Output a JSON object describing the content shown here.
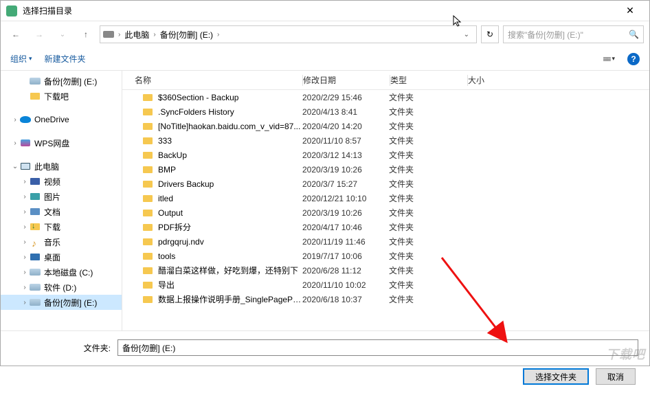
{
  "window": {
    "title": "选择扫描目录"
  },
  "breadcrumb": {
    "root": "此电脑",
    "path": "备份[勿删] (E:)"
  },
  "search": {
    "placeholder": "搜索\"备份[勿删] (E:)\""
  },
  "toolbar": {
    "organize": "组织",
    "new_folder": "新建文件夹"
  },
  "sidebar": {
    "items": [
      {
        "label": "备份[勿删] (E:)",
        "icon": "drive",
        "indent": 2,
        "expander": ""
      },
      {
        "label": "下载吧",
        "icon": "folder",
        "indent": 2,
        "expander": ""
      },
      {
        "label": "OneDrive",
        "icon": "onedrive",
        "indent": 1,
        "expander": "›"
      },
      {
        "label": "WPS网盘",
        "icon": "wps",
        "indent": 1,
        "expander": "›"
      },
      {
        "label": "此电脑",
        "icon": "pc",
        "indent": 1,
        "expander": "⌄"
      },
      {
        "label": "视频",
        "icon": "video",
        "indent": 2,
        "expander": "›"
      },
      {
        "label": "图片",
        "icon": "pic",
        "indent": 2,
        "expander": "›"
      },
      {
        "label": "文档",
        "icon": "doc",
        "indent": 2,
        "expander": "›"
      },
      {
        "label": "下载",
        "icon": "folder dl",
        "indent": 2,
        "expander": "›"
      },
      {
        "label": "音乐",
        "icon": "music",
        "indent": 2,
        "expander": "›"
      },
      {
        "label": "桌面",
        "icon": "desktop",
        "indent": 2,
        "expander": "›"
      },
      {
        "label": "本地磁盘 (C:)",
        "icon": "drive",
        "indent": 2,
        "expander": "›"
      },
      {
        "label": "软件 (D:)",
        "icon": "drive",
        "indent": 2,
        "expander": "›"
      },
      {
        "label": "备份[勿删] (E:)",
        "icon": "drive",
        "indent": 2,
        "expander": "›",
        "selected": true
      }
    ]
  },
  "columns": {
    "name": "名称",
    "date": "修改日期",
    "type": "类型",
    "size": "大小"
  },
  "files": [
    {
      "name": "$360Section - Backup",
      "date": "2020/2/29 15:46",
      "type": "文件夹"
    },
    {
      "name": ".SyncFolders History",
      "date": "2020/4/13 8:41",
      "type": "文件夹"
    },
    {
      "name": "[NoTitle]haokan.baidu.com_v_vid=87...",
      "date": "2020/4/20 14:20",
      "type": "文件夹"
    },
    {
      "name": "333",
      "date": "2020/11/10 8:57",
      "type": "文件夹"
    },
    {
      "name": "BackUp",
      "date": "2020/3/12 14:13",
      "type": "文件夹"
    },
    {
      "name": "BMP",
      "date": "2020/3/19 10:26",
      "type": "文件夹"
    },
    {
      "name": "Drivers Backup",
      "date": "2020/3/7 15:27",
      "type": "文件夹"
    },
    {
      "name": "itled",
      "date": "2020/12/21 10:10",
      "type": "文件夹"
    },
    {
      "name": "Output",
      "date": "2020/3/19 10:26",
      "type": "文件夹"
    },
    {
      "name": "PDF拆分",
      "date": "2020/4/17 10:46",
      "type": "文件夹"
    },
    {
      "name": "pdrgqruj.ndv",
      "date": "2020/11/19 11:46",
      "type": "文件夹"
    },
    {
      "name": "tools",
      "date": "2019/7/17 10:06",
      "type": "文件夹"
    },
    {
      "name": "醋溜白菜这样做，好吃到爆，还特别下",
      "date": "2020/6/28 11:12",
      "type": "文件夹"
    },
    {
      "name": "导出",
      "date": "2020/11/10 10:02",
      "type": "文件夹"
    },
    {
      "name": "数据上报操作说明手册_SinglePagePDF",
      "date": "2020/6/18 10:37",
      "type": "文件夹"
    }
  ],
  "footer": {
    "folder_label": "文件夹:",
    "folder_value": "备份[勿删] (E:)",
    "select_btn": "选择文件夹",
    "cancel_btn": "取消"
  },
  "watermark": "下载吧"
}
